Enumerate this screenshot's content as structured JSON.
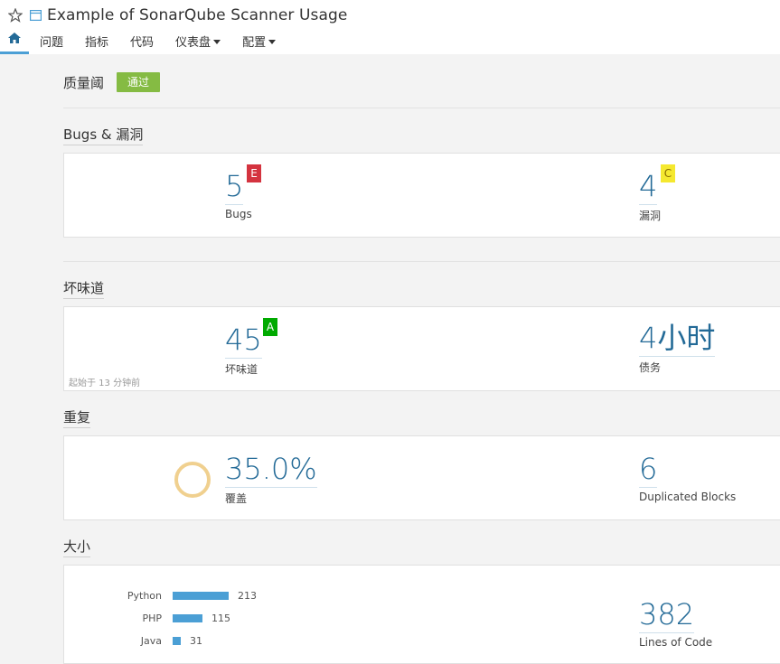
{
  "header": {
    "project_title": "Example of SonarQube Scanner Usage",
    "icons": {
      "favorite": "star-outline-icon",
      "project": "project-window-icon",
      "home": "home-icon"
    },
    "nav": [
      {
        "label": "问题"
      },
      {
        "label": "指标"
      },
      {
        "label": "代码"
      },
      {
        "label": "仪表盘",
        "dropdown": true
      },
      {
        "label": "配置",
        "dropdown": true
      }
    ]
  },
  "quality_gate": {
    "label": "质量阈",
    "status": "通过",
    "status_color": "#85bb43"
  },
  "sections": {
    "reliability": {
      "title": "Bugs & 漏洞",
      "bugs": {
        "value": "5",
        "label": "Bugs",
        "rating": "E",
        "rating_color": "#d4333f"
      },
      "vulnerabilities": {
        "value": "4",
        "label": "漏洞",
        "rating": "C",
        "rating_color": "#eabe06"
      }
    },
    "maintainability": {
      "title": "坏味道",
      "code_smells": {
        "value": "45",
        "label": "坏味道",
        "rating": "A",
        "rating_color": "#00aa00"
      },
      "debt": {
        "value": "4",
        "unit": "小时",
        "label": "债务"
      },
      "since": "起始于 13 分钟前"
    },
    "duplications": {
      "title": "重复",
      "coverage": {
        "value": "35.0%",
        "label": "覆盖",
        "donut_color": "#f0d08f"
      },
      "duplicated_blocks": {
        "value": "6",
        "label": "Duplicated Blocks"
      }
    },
    "size": {
      "title": "大小",
      "languages": [
        {
          "name": "Python",
          "value": 213
        },
        {
          "name": "PHP",
          "value": 115
        },
        {
          "name": "Java",
          "value": 31
        }
      ],
      "lines_of_code": {
        "value": "382",
        "label": "Lines of Code"
      }
    }
  },
  "colors": {
    "accent": "#4b9fd5",
    "metric": "#236a97"
  }
}
